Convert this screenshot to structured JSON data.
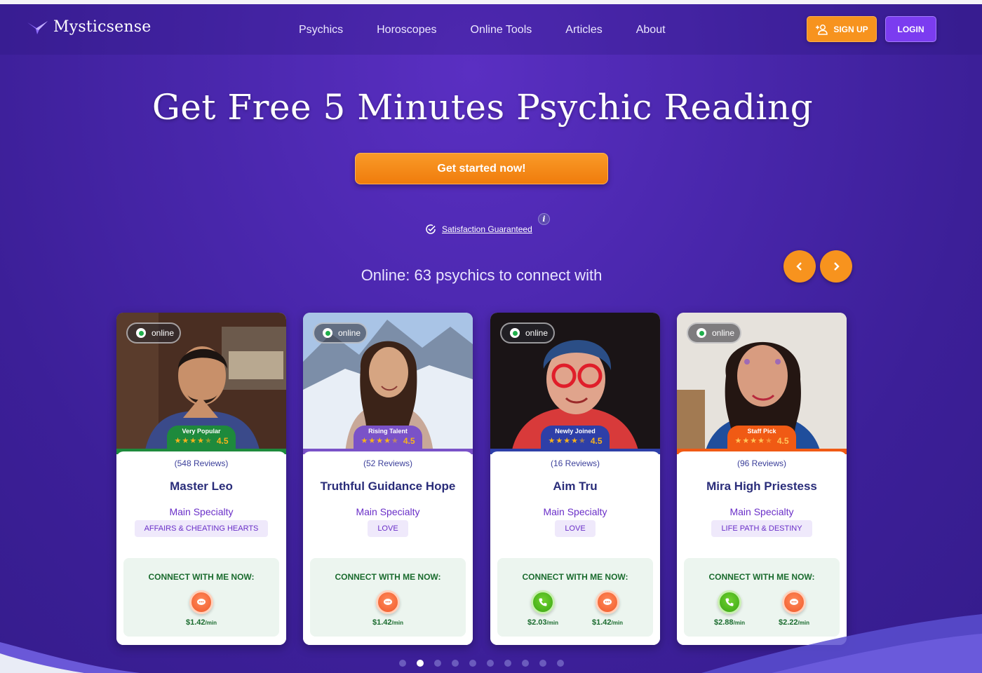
{
  "header": {
    "logo_text": "Mysticsense",
    "nav": [
      "Psychics",
      "Horoscopes",
      "Online Tools",
      "Articles",
      "About"
    ],
    "signup_label": "SIGN UP",
    "login_label": "LOGIN"
  },
  "hero": {
    "title": "Get Free 5 Minutes Psychic Reading",
    "cta_label": "Get started now!",
    "satisfaction_label": "Satisfaction Guaranteed",
    "info_glyph": "i",
    "online_text": "Online: 63 psychics to connect with"
  },
  "colors": {
    "accent_orange": "#f7931e",
    "accent_purple": "#7b3cf0",
    "background": "#4a27ad"
  },
  "cards": [
    {
      "status": "online",
      "badge": "Very Popular",
      "badge_color": "#1e8a3c",
      "rating": "4.5",
      "reviews": "(548 Reviews)",
      "name": "Master Leo",
      "specialty_label": "Main Specialty",
      "specialty": "AFFAIRS & CHEATING HEARTS",
      "connect_title": "CONNECT WITH ME NOW:",
      "services": [
        {
          "type": "chat",
          "price": "$1.42",
          "unit": "/min"
        }
      ]
    },
    {
      "status": "online",
      "badge": "Rising Talent",
      "badge_color": "#7a52c8",
      "rating": "4.5",
      "reviews": "(52 Reviews)",
      "name": "Truthful Guidance Hope",
      "specialty_label": "Main Specialty",
      "specialty": "LOVE",
      "connect_title": "CONNECT WITH ME NOW:",
      "services": [
        {
          "type": "chat",
          "price": "$1.42",
          "unit": "/min"
        }
      ]
    },
    {
      "status": "online",
      "badge": "Newly Joined",
      "badge_color": "#2e3fa8",
      "rating": "4.5",
      "reviews": "(16 Reviews)",
      "name": "Aim Tru",
      "specialty_label": "Main Specialty",
      "specialty": "LOVE",
      "connect_title": "CONNECT WITH ME NOW:",
      "services": [
        {
          "type": "call",
          "price": "$2.03",
          "unit": "/min"
        },
        {
          "type": "chat",
          "price": "$1.42",
          "unit": "/min"
        }
      ]
    },
    {
      "status": "online",
      "badge": "Staff Pick",
      "badge_color": "#f05a14",
      "rating": "4.5",
      "reviews": "(96 Reviews)",
      "name": "Mira High Priestess",
      "specialty_label": "Main Specialty",
      "specialty": "LIFE PATH & DESTINY",
      "connect_title": "CONNECT WITH ME NOW:",
      "services": [
        {
          "type": "call",
          "price": "$2.88",
          "unit": "/min"
        },
        {
          "type": "chat",
          "price": "$2.22",
          "unit": "/min"
        }
      ]
    }
  ],
  "carousel": {
    "page_count": 10,
    "active_index": 1
  }
}
